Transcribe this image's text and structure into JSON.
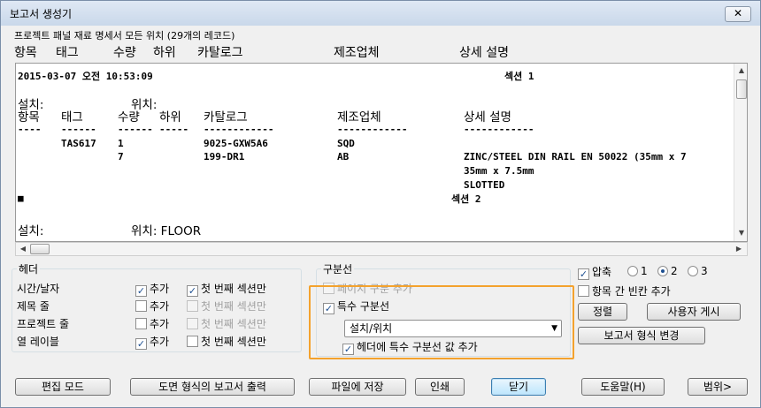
{
  "window": {
    "title": "보고서 생성기",
    "close": "✕"
  },
  "subtitle": "프로젝트 패널 재료 명세서 모든 위치 (29개의 레코드)",
  "columns": [
    "항목",
    "태그",
    "수량",
    "하위",
    "카탈로그",
    "제조업체",
    "상세 설명"
  ],
  "report": {
    "datetime": "2015-03-07 오전 10:53:09",
    "section1": "섹션 1",
    "install_label": "설치:",
    "location_label": "위치:",
    "dashes": [
      "----",
      "------",
      "------",
      "-----",
      "------------",
      "------------",
      "------------"
    ],
    "rows": [
      {
        "tag": "TAS617",
        "qty": "1",
        "catalog": "9025-GXW5A6",
        "mfr": "SQD",
        "desc": ""
      },
      {
        "tag": "",
        "qty": "7",
        "catalog": "199-DR1",
        "mfr": "AB",
        "desc": "ZINC/STEEL DIN RAIL EN 50022 (35mm x 7"
      }
    ],
    "desc_cont1": "35mm x 7.5mm",
    "desc_cont2": "SLOTTED",
    "cursor": "■",
    "section2": "섹션 2",
    "install2": "설치:",
    "location2": "위치: FLOOR"
  },
  "header_group": {
    "title": "헤더",
    "rows": [
      {
        "label": "시간/날자",
        "add": "추가",
        "first": "첫 번째 섹션만"
      },
      {
        "label": "제목 줄",
        "add": "추가",
        "first": "첫 번째 섹션만"
      },
      {
        "label": "프로젝트 줄",
        "add": "추가",
        "first": "첫 번째 섹션만"
      },
      {
        "label": "열 레이블",
        "add": "추가",
        "first": "첫 번째 섹션만"
      }
    ]
  },
  "section_group": {
    "title": "구분선",
    "page_break": "페이지 구분 추가",
    "special": "특수 구분선",
    "select_value": "설치/위치",
    "add_header": "헤더에 특수 구분선 값 추가"
  },
  "compress": {
    "label": "압축",
    "opt1": "1",
    "opt2": "2",
    "opt3": "3"
  },
  "blank_line": "항목 간 빈칸 추가",
  "buttons": {
    "sort": "정렬",
    "user_post": "사용자 게시",
    "change_format": "보고서 형식 변경",
    "edit_mode": "편집 모드",
    "print_drawing": "도면 형식의 보고서 출력",
    "save_file": "파일에 저장",
    "print": "인쇄",
    "close": "닫기",
    "help": "도움말(H)",
    "range": "범위>"
  },
  "check": "✓",
  "arrows": {
    "up": "▲",
    "down": "▼",
    "left": "◀",
    "right": "▶",
    "dropdown": "▼"
  }
}
